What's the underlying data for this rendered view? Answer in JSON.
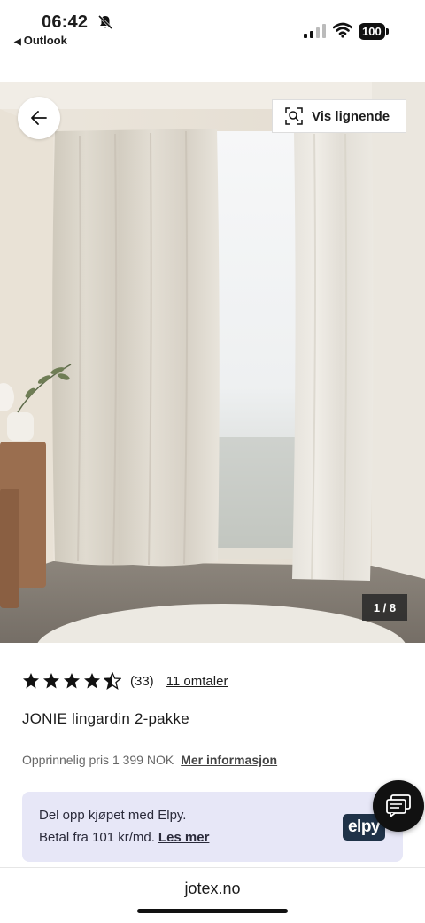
{
  "status_bar": {
    "time": "06:42",
    "back_app": "Outlook",
    "battery": "100"
  },
  "gallery": {
    "similar_label": "Vis lignende",
    "counter": "1 / 8"
  },
  "product": {
    "rating": 4.5,
    "rating_count": "(33)",
    "reviews_link": "11 omtaler",
    "title": "JONIE lingardin 2-pakke",
    "original_price": "Opprinnelig pris 1 399 NOK",
    "more_info": "Mer informasjon"
  },
  "elpy": {
    "line1": "Del opp kjøpet med Elpy.",
    "line2": "Betal fra 101 kr/md.",
    "link": "Les mer",
    "logo": "elpy"
  },
  "browser": {
    "url": "jotex.no"
  },
  "icons": [
    "bell-slash-icon",
    "signal-icon",
    "wifi-icon",
    "battery-icon",
    "arrow-left-icon",
    "visual-search-icon",
    "star-icon",
    "chat-icon"
  ],
  "colors": {
    "banner_bg": "#e7e7f7",
    "elpy_logo_bg": "#1f3248",
    "text": "#1c1c1c"
  }
}
